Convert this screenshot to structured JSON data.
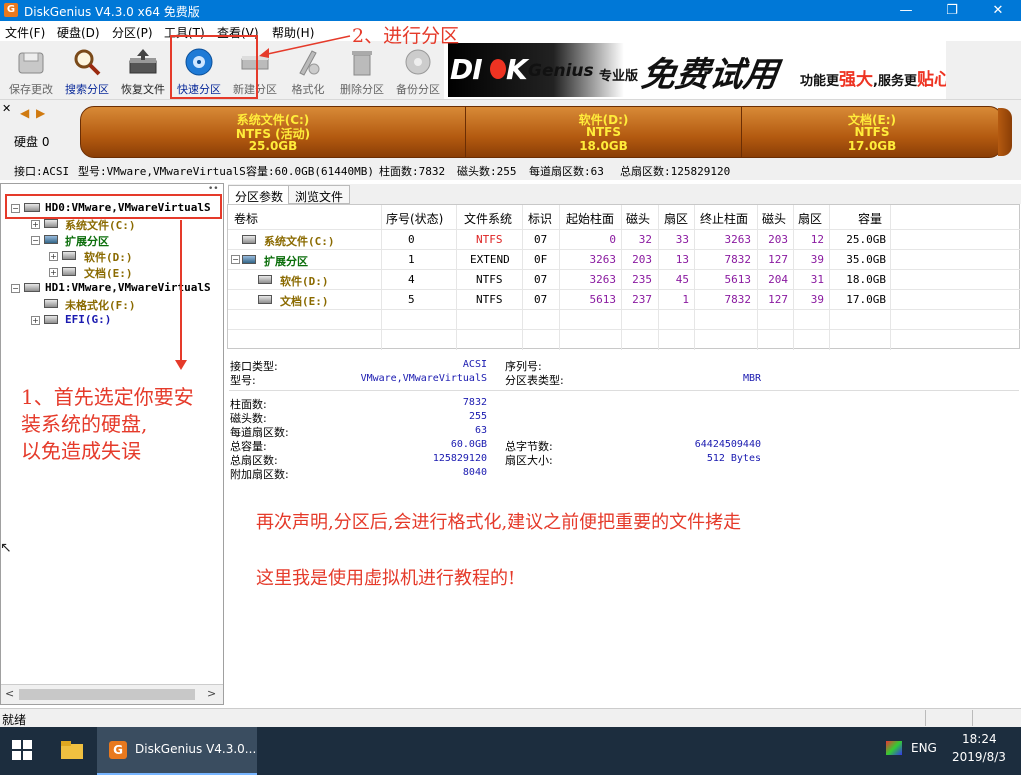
{
  "window": {
    "title": "DiskGenius V4.3.0 x64 免费版",
    "app_icon": "G",
    "controls": {
      "minimize": "—",
      "maximize": "❐",
      "close": "✕"
    }
  },
  "menu": [
    "文件(F)",
    "硬盘(D)",
    "分区(P)",
    "工具(T)",
    "查看(V)",
    "帮助(H)"
  ],
  "toolbar": [
    {
      "label": "保存更改",
      "icon": "save-changes-icon",
      "enabled": false
    },
    {
      "label": "搜索分区",
      "icon": "search-partition-icon",
      "enabled": true
    },
    {
      "label": "恢复文件",
      "icon": "recover-files-icon",
      "enabled": true
    },
    {
      "label": "快速分区",
      "icon": "quick-partition-icon",
      "enabled": true
    },
    {
      "label": "新建分区",
      "icon": "new-partition-icon",
      "enabled": false
    },
    {
      "label": "格式化",
      "icon": "format-icon",
      "enabled": false
    },
    {
      "label": "删除分区",
      "icon": "delete-partition-icon",
      "enabled": false
    },
    {
      "label": "备份分区",
      "icon": "backup-partition-icon",
      "enabled": false
    }
  ],
  "banner": {
    "logo_a": "DI",
    "logo_b": "K",
    "logo_c": "Genius",
    "edition": "专业版",
    "trial": "免费试用",
    "slogan_a": "功能更",
    "slogan_b": "强大",
    "slogan_c": ",服务更",
    "slogan_d": "贴心"
  },
  "disk": {
    "label": "硬盘 0",
    "partitions": [
      {
        "name": "系统文件(C:)",
        "fs": "NTFS (活动)",
        "size": "25.0GB"
      },
      {
        "name": "软件(D:)",
        "fs": "NTFS",
        "size": "18.0GB"
      },
      {
        "name": "文档(E:)",
        "fs": "NTFS",
        "size": "17.0GB"
      }
    ],
    "info": {
      "interface": "接口:ACSI",
      "model": "型号:VMware,VMwareVirtualS",
      "capacity": "容量:60.0GB(61440MB)",
      "cylinders": "柱面数:7832",
      "heads": "磁头数:255",
      "sectors_per_track": "每道扇区数:63",
      "total_sectors": "总扇区数:125829120"
    }
  },
  "tree": {
    "hd0": "HD0:VMware,VMwareVirtualS",
    "hd0_children": [
      "系统文件(C:)",
      "扩展分区",
      "软件(D:)",
      "文档(E:)"
    ],
    "hd1": "HD1:VMware,VMwareVirtualS",
    "hd1_children": [
      "未格式化(F:)",
      "EFI(G:)"
    ]
  },
  "tabs": [
    "分区参数",
    "浏览文件"
  ],
  "partition_table": {
    "headers": [
      "卷标",
      "序号(状态)",
      "文件系统",
      "标识",
      "起始柱面",
      "磁头",
      "扇区",
      "终止柱面",
      "磁头",
      "扇区",
      "容量"
    ],
    "rows": [
      [
        "系统文件(C:)",
        "0",
        "NTFS",
        "07",
        "0",
        "32",
        "33",
        "3263",
        "203",
        "12",
        "25.0GB"
      ],
      [
        "扩展分区",
        "1",
        "EXTEND",
        "0F",
        "3263",
        "203",
        "13",
        "7832",
        "127",
        "39",
        "35.0GB"
      ],
      [
        "软件(D:)",
        "4",
        "NTFS",
        "07",
        "3263",
        "235",
        "45",
        "5613",
        "204",
        "31",
        "18.0GB"
      ],
      [
        "文档(E:)",
        "5",
        "NTFS",
        "07",
        "5613",
        "237",
        "1",
        "7832",
        "127",
        "39",
        "17.0GB"
      ]
    ]
  },
  "details": {
    "interface_type_label": "接口类型:",
    "interface_type": "ACSI",
    "serial_label": "序列号:",
    "model_label": "型号:",
    "model": "VMware,VMwareVirtualS",
    "pt_type_label": "分区表类型:",
    "pt_type": "MBR",
    "cylinders_label": "柱面数:",
    "cylinders": "7832",
    "heads_label": "磁头数:",
    "heads": "255",
    "spt_label": "每道扇区数:",
    "spt": "63",
    "capacity_label": "总容量:",
    "capacity": "60.0GB",
    "total_bytes_label": "总字节数:",
    "total_bytes": "64424509440",
    "total_sectors_label": "总扇区数:",
    "total_sectors": "125829120",
    "sector_size_label": "扇区大小:",
    "sector_size": "512 Bytes",
    "extra_sectors_label": "附加扇区数:",
    "extra_sectors": "8040"
  },
  "annotations": {
    "step2": "2、进行分区",
    "step1_a": "1、首先选定你要安",
    "step1_b": "装系统的硬盘,",
    "step1_c": "以免造成失误",
    "note_a": "再次声明,分区后,会进行格式化,建议之前便把重要的文件拷走",
    "note_b": "这里我是使用虚拟机进行教程的!"
  },
  "status": "就绪",
  "taskbar": {
    "app": "DiskGenius V4.3.0...",
    "lang": "ENG",
    "time": "18:24",
    "date": "2019/8/3"
  },
  "colors": {
    "titlebar": "#0078d7",
    "annotation": "#e53a2a",
    "partition_text": "#ffec3a"
  }
}
